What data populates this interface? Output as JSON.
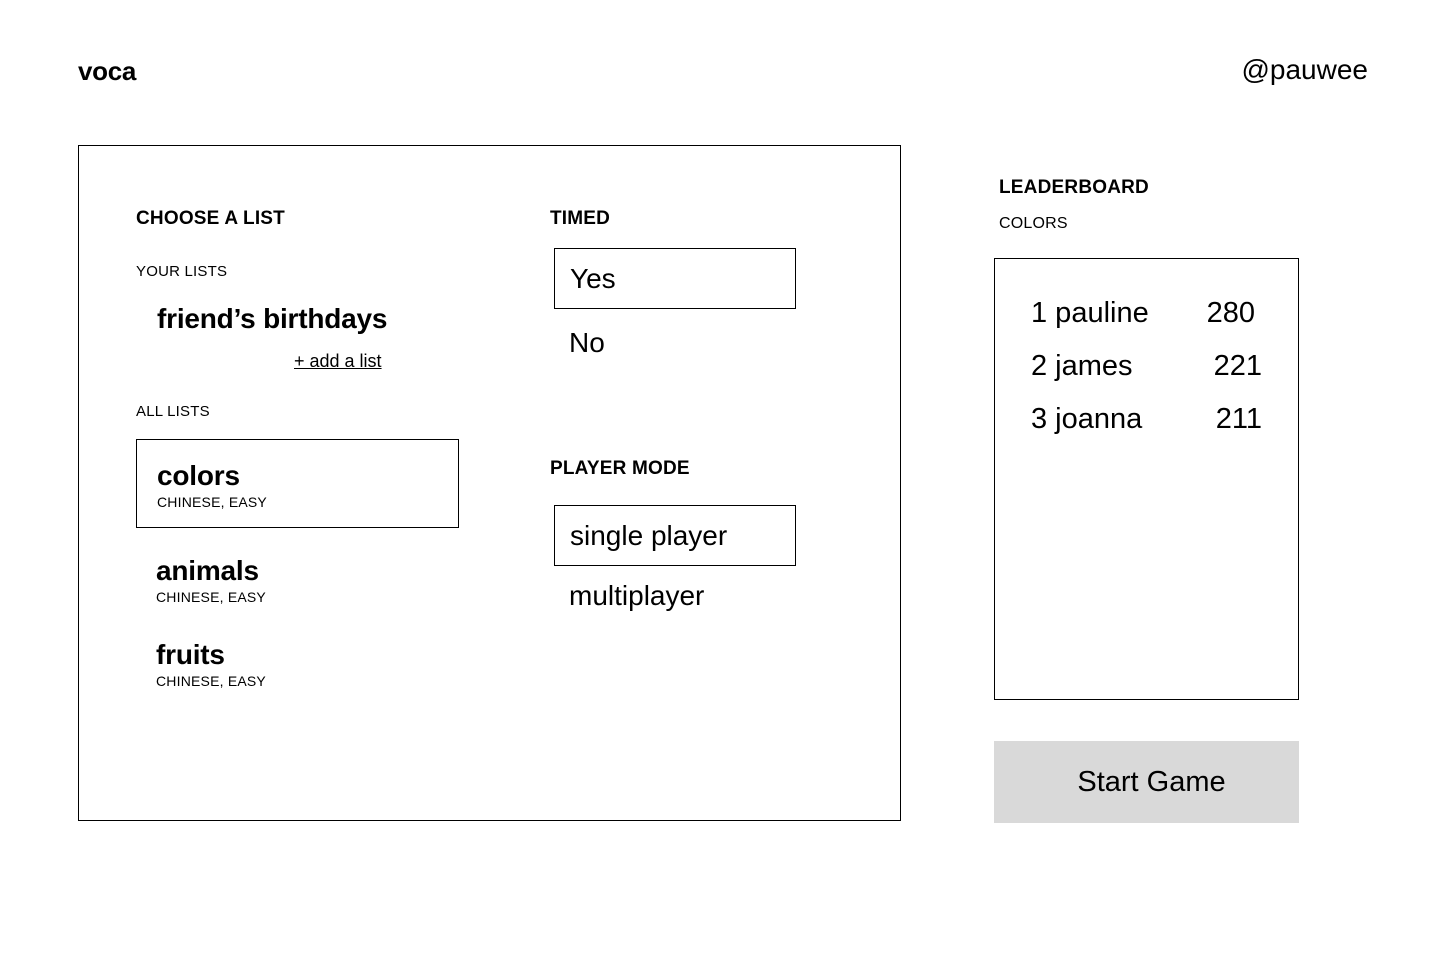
{
  "header": {
    "brand": "voca",
    "username": "@pauwee"
  },
  "choose_list": {
    "heading": "CHOOSE A LIST",
    "your_lists_label": "YOUR LISTS",
    "your_lists": [
      {
        "title": "friend’s birthdays"
      }
    ],
    "add_list_label": "+ add a list",
    "all_lists_label": "ALL LISTS",
    "all_lists": [
      {
        "title": "colors",
        "meta": "CHINESE, EASY",
        "selected": true
      },
      {
        "title": "animals",
        "meta": "CHINESE, EASY",
        "selected": false
      },
      {
        "title": "fruits",
        "meta": "CHINESE, EASY",
        "selected": false
      }
    ]
  },
  "timed": {
    "heading": "TIMED",
    "options": [
      "Yes",
      "No"
    ],
    "selected": "Yes"
  },
  "player_mode": {
    "heading": "PLAYER MODE",
    "options": [
      "single player",
      "multiplayer"
    ],
    "selected": "single player"
  },
  "leaderboard": {
    "heading": "LEADERBOARD",
    "list_name": "COLORS",
    "entries": [
      {
        "rank_name": "1 pauline",
        "score": "280"
      },
      {
        "rank_name": "2 james",
        "score": "221"
      },
      {
        "rank_name": "3 joanna",
        "score": "211"
      }
    ]
  },
  "start_button_label": "Start Game"
}
